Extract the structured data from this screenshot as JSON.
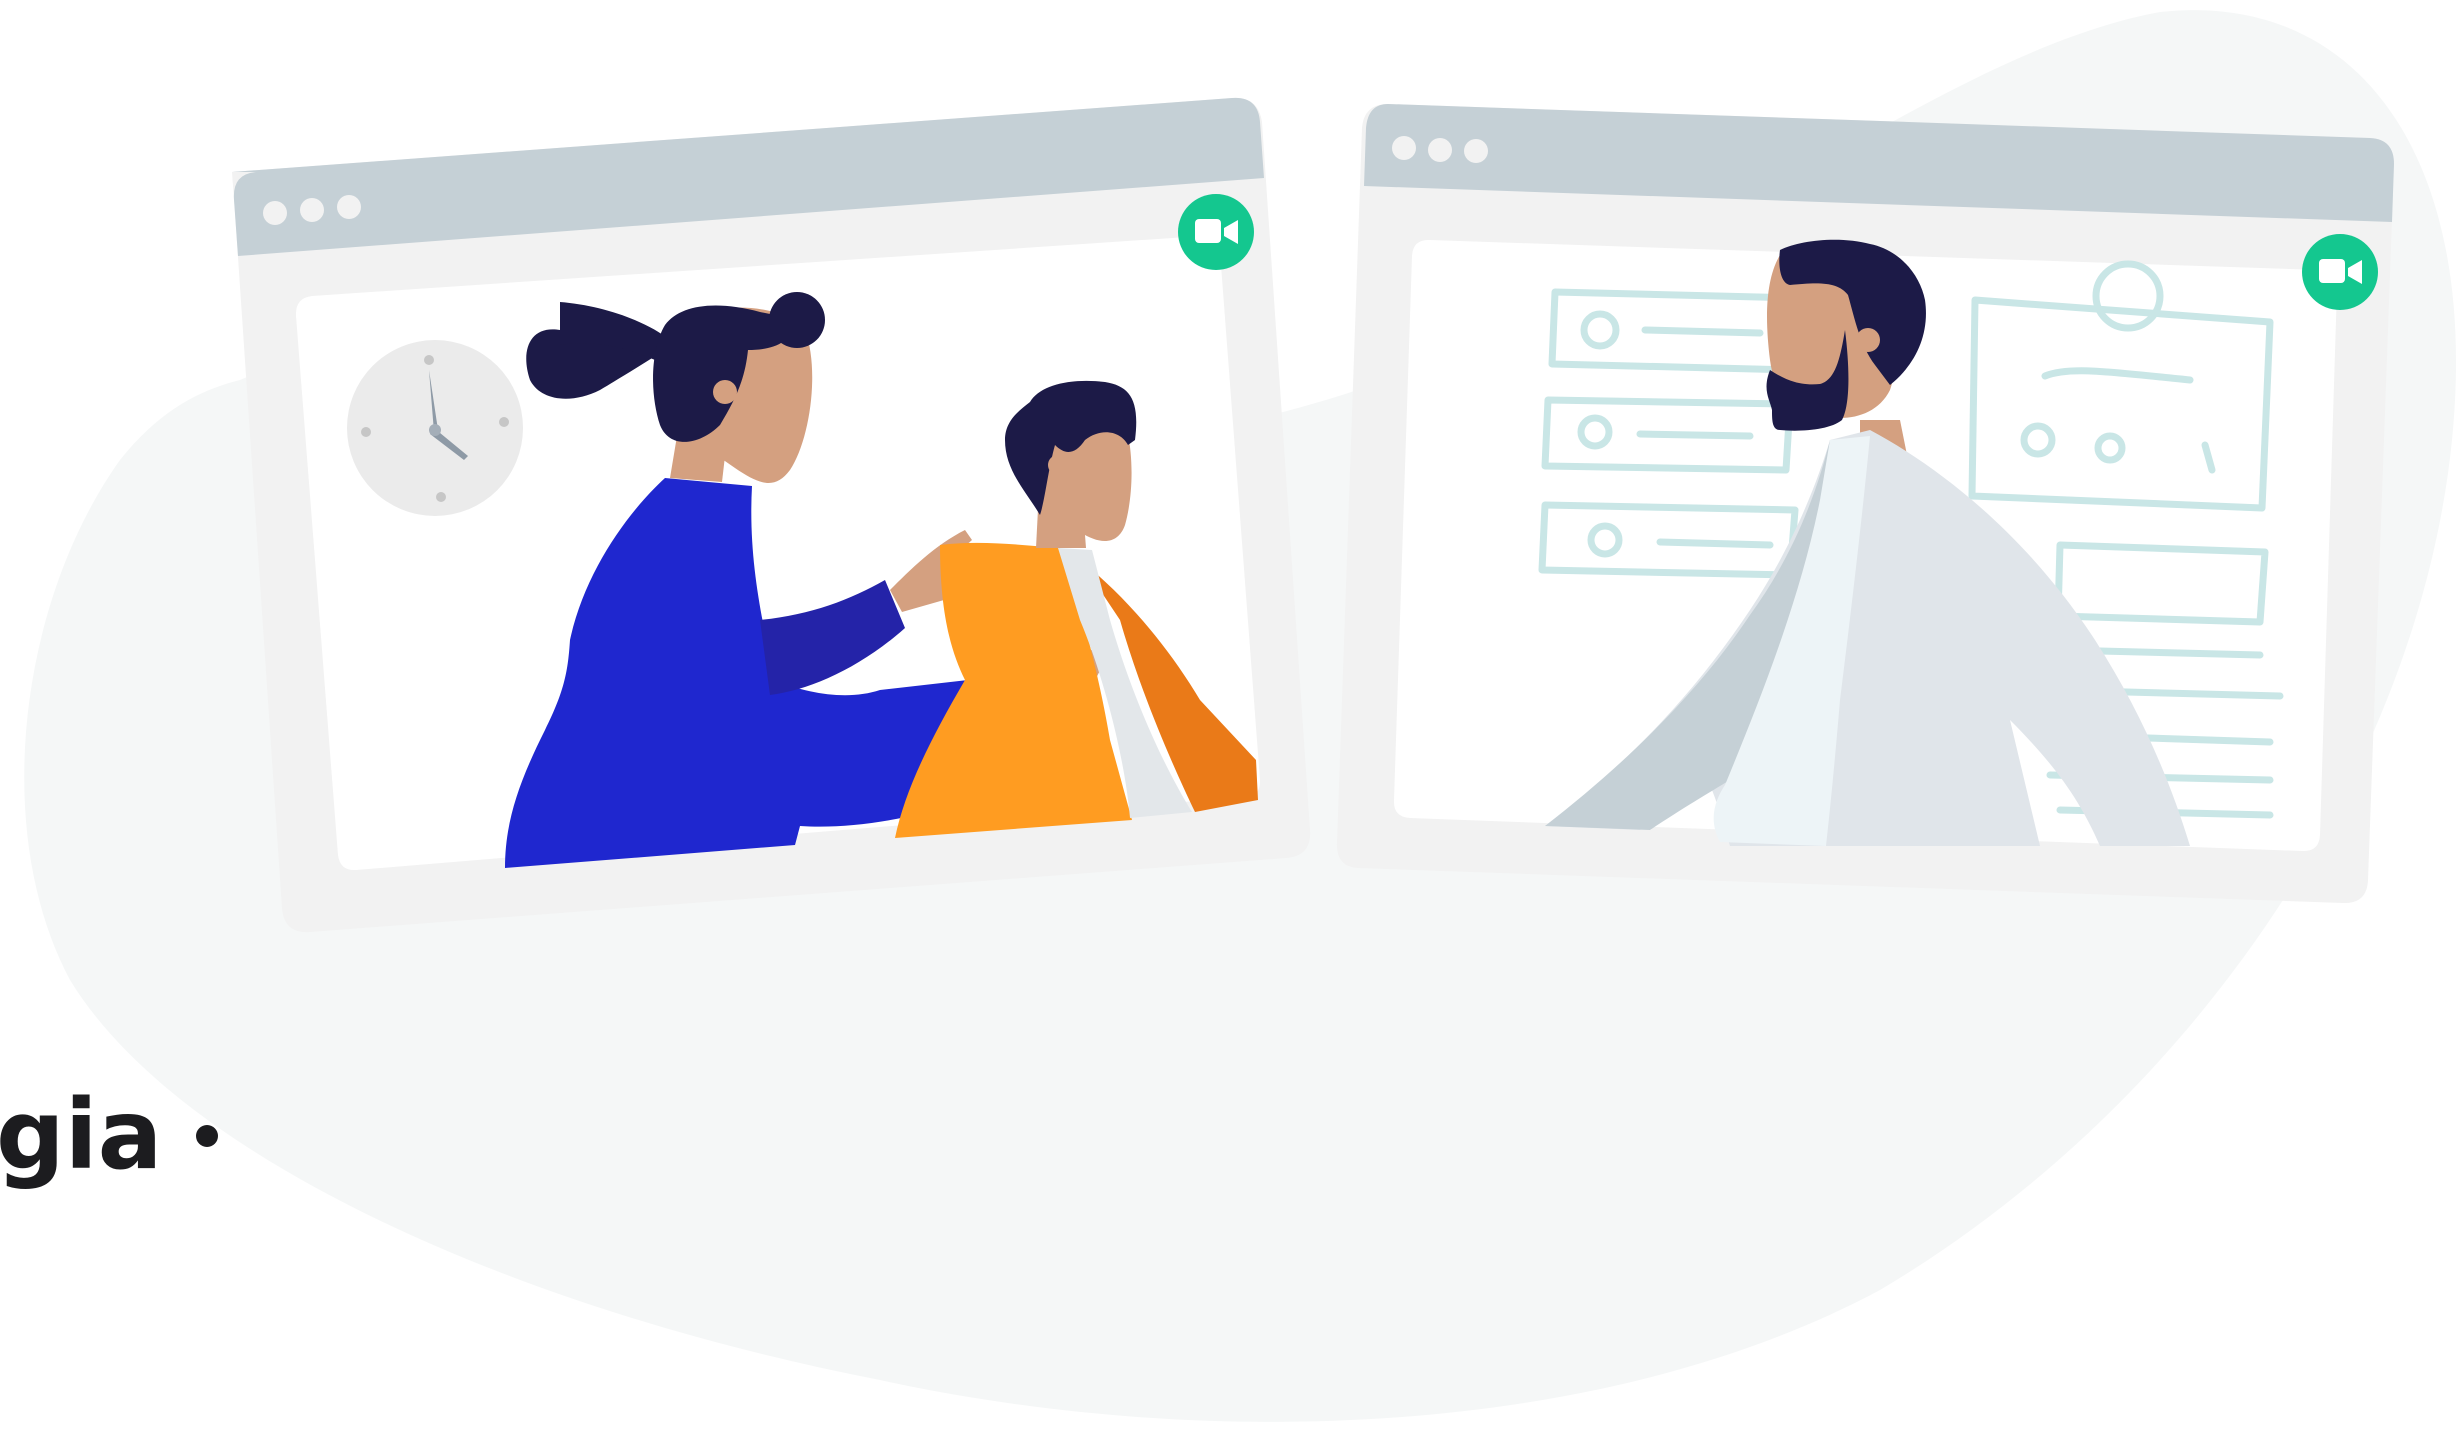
{
  "caption": {
    "text": "gia"
  },
  "windows": [
    {
      "name": "left-call-window",
      "call_icon": "video-camera-icon",
      "scene": "clock-and-family"
    },
    {
      "name": "right-call-window",
      "call_icon": "video-camera-icon",
      "scene": "doctor-with-chart-sketch"
    }
  ],
  "colors": {
    "background_blob": "#f5f7f7",
    "window_frame": "#f2f2f2",
    "window_titlebar": "#c5d0d6",
    "call_badge": "#14c78f",
    "navy": "#1c1a47",
    "skin": "#d4a080",
    "blue_coat": "#1f27cf",
    "orange": "#ff9c21",
    "white_coat": "#e0e5ea",
    "sketch": "#c9e6e6"
  }
}
